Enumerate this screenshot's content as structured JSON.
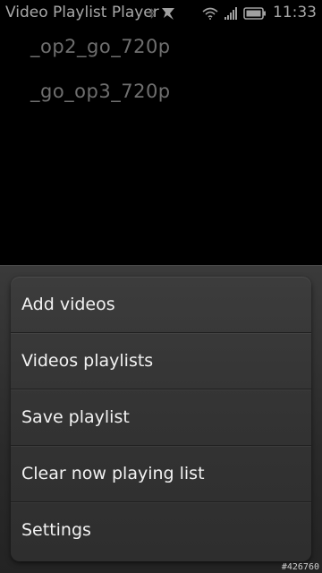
{
  "status_bar": {
    "app_title": "Video Playlist Player",
    "clock": "11:33",
    "icons": [
      "bluetooth-icon",
      "notification-icon",
      "wifi-icon",
      "signal-icon",
      "battery-icon"
    ]
  },
  "playlist": {
    "items": [
      {
        "label": "_op2_go_720p"
      },
      {
        "label": "_go_op3_720p"
      }
    ]
  },
  "menu": {
    "items": [
      {
        "label": "Add videos"
      },
      {
        "label": "Videos playlists"
      },
      {
        "label": "Save playlist"
      },
      {
        "label": "Clear now playing list"
      },
      {
        "label": "Settings"
      }
    ]
  },
  "watermark": "#426760",
  "colors": {
    "background": "#000000",
    "menu_text": "#f2f2f2",
    "playlist_text": "#6f6f6f"
  }
}
